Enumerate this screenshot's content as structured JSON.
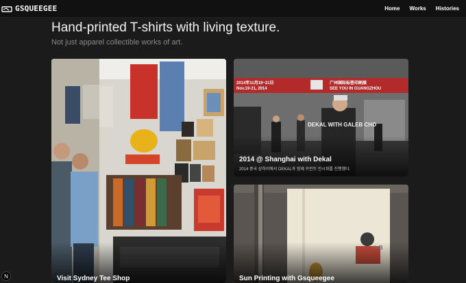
{
  "brand": {
    "name": "GSQUEEGEE",
    "icon": "squeegee-logo-icon"
  },
  "nav": {
    "items": [
      "Home",
      "Works",
      "Histories"
    ]
  },
  "hero": {
    "title": "Hand-printed T-shirts with living texture.",
    "subtitle": "Not just apparel collectible works of art."
  },
  "cards": [
    {
      "title": "Visit Sydney Tee Shop"
    },
    {
      "title": "2014 @ Shanghai with Dekal",
      "description": "2014 중국 상하이에서 DEKAL과 함께 프린트 전시회를 진행했다.",
      "photo_text": {
        "banner_left": "2014年11月19~21日\nNov.19-21, 2014",
        "banner_right": "广州国际标签印刷展\nSEE YOU IN GUANGZHOU",
        "caption": "DEKAL WITH GALEB CHO"
      }
    },
    {
      "title": "Sun Printing with Gsqueegee"
    }
  ],
  "badge": {
    "label": "N"
  }
}
